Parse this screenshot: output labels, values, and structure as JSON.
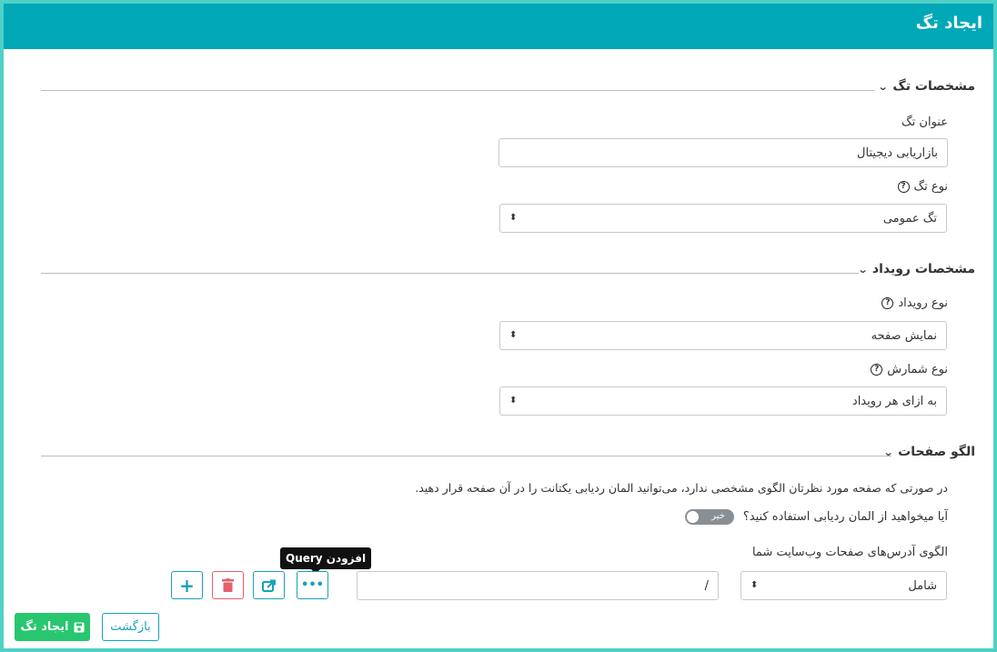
{
  "header": {
    "title": "ایجاد تگ"
  },
  "sections": {
    "tag": {
      "title": "مشخصات تگ"
    },
    "event": {
      "title": "مشخصات رویداد"
    },
    "pages": {
      "title": "الگو صفحات"
    }
  },
  "tag_form": {
    "title_label": "عنوان تگ",
    "title_value": "بازاریابی دیجیتال",
    "type_label": "نوع تگ",
    "type_value": "تگ عمومی"
  },
  "event_form": {
    "event_type_label": "نوع رویداد",
    "event_type_value": "نمایش صفحه",
    "count_type_label": "نوع شمارش",
    "count_type_value": "به ازای هر رویداد"
  },
  "pages_form": {
    "description": "در صورتی که صفحه مورد نظرتان الگوی مشخصی ندارد، می‌توانید المان ردیابی یکتانت را در آن صفحه قرار دهید.",
    "toggle_label": "آیا میخواهید از المان ردیابی استفاده کنید؟",
    "toggle_state": "خیر",
    "pattern_label": "الگوی آدرس‌های صفحات وب‌سایت شما",
    "match_value": "شامل",
    "path_value": "/",
    "tooltip": "افزودن Query"
  },
  "icons": {
    "help": "question-circle-icon",
    "more": "ellipsis-icon",
    "share": "share-icon",
    "delete": "trash-icon",
    "add": "plus-icon",
    "save": "floppy-disk-icon"
  },
  "actions": {
    "create_label": "ایجاد تگ",
    "back_label": "بازگشت"
  },
  "colors": {
    "header": "#00a8b8",
    "frame": "#4fd1c5",
    "primary": "#28c76f",
    "info": "#17a2b8",
    "danger": "#e4606d"
  }
}
